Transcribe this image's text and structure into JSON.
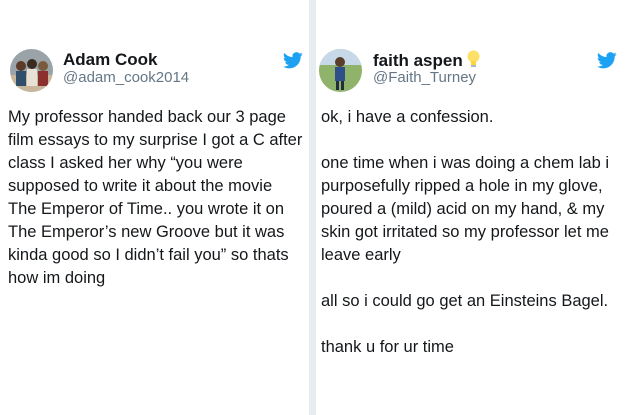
{
  "left_tweet": {
    "name": "Adam Cook",
    "handle": "@adam_cook2014",
    "avatar_icon": "avatar-photo-icon",
    "twitter_icon": "twitter-bird-icon",
    "text": "My professor handed back our 3 page film essays to my surprise I got a C after class I asked her why  “you were supposed to write it about the movie The Emperor of Time.. you wrote it on The Emperor’s new Groove but it was kinda good so I didn’t fail you” so thats how im doing"
  },
  "right_tweet": {
    "name": "faith aspen",
    "name_emoji": "light-bulb-icon",
    "handle": "@Faith_Turney",
    "avatar_icon": "avatar-photo-icon",
    "twitter_icon": "twitter-bird-icon",
    "paragraphs": [
      "ok, i have a confession.",
      "one time when i was doing a chem lab i purposefully ripped a hole in my glove, poured a (mild) acid on my hand, & my skin got irritated so my professor let me leave early",
      "all so i could go get an Einsteins Bagel.",
      "thank u for ur time"
    ]
  },
  "colors": {
    "twitter_blue": "#1da1f2",
    "text": "#14171a",
    "handle_gray": "#657786",
    "divider": "#e6ecf0"
  }
}
